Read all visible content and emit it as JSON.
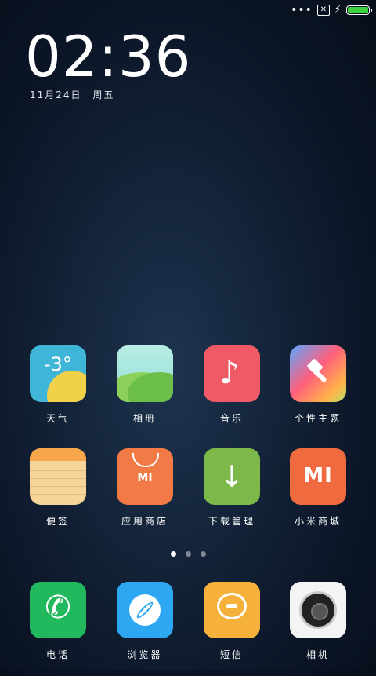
{
  "status_bar": {
    "dots": "•••",
    "notification_icon": "close-box-icon",
    "charging_icon": "bolt-icon",
    "battery_level": 1.0,
    "battery_color": "#3fd13f"
  },
  "lockscreen": {
    "time": "02:36",
    "date": "11月24日",
    "weekday": "周五"
  },
  "apps_row1": [
    {
      "label": "天气",
      "icon": "weather-icon",
      "text": "-3°"
    },
    {
      "label": "相册",
      "icon": "gallery-icon"
    },
    {
      "label": "音乐",
      "icon": "music-icon",
      "glyph": "♪"
    },
    {
      "label": "个性主题",
      "icon": "themes-icon"
    }
  ],
  "apps_row2": [
    {
      "label": "便签",
      "icon": "notes-icon"
    },
    {
      "label": "应用商店",
      "icon": "app-store-icon",
      "text": "MI"
    },
    {
      "label": "下载管理",
      "icon": "download-icon",
      "glyph": "↓"
    },
    {
      "label": "小米商城",
      "icon": "mi-store-icon",
      "text": "MI"
    }
  ],
  "pager": {
    "count": 3,
    "active": 0
  },
  "dock": [
    {
      "label": "电话",
      "icon": "phone-icon",
      "glyph": "✆"
    },
    {
      "label": "浏览器",
      "icon": "browser-icon"
    },
    {
      "label": "短信",
      "icon": "message-icon"
    },
    {
      "label": "相机",
      "icon": "camera-icon"
    }
  ]
}
